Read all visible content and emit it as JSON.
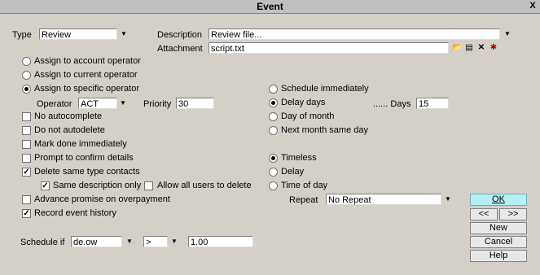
{
  "window": {
    "title": "Event",
    "close": "X"
  },
  "type": {
    "label": "Type",
    "value": "Review"
  },
  "description": {
    "label": "Description",
    "value": "Review file..."
  },
  "attachment": {
    "label": "Attachment",
    "value": "script.txt"
  },
  "assign_options": [
    {
      "label": "Assign to account operator",
      "selected": false
    },
    {
      "label": "Assign to current operator",
      "selected": false
    },
    {
      "label": "Assign to specific operator",
      "selected": true
    }
  ],
  "operator": {
    "label": "Operator",
    "value": "ACT"
  },
  "priority": {
    "label": "Priority",
    "value": "30"
  },
  "checks": {
    "no_autocomplete": {
      "label": "No autocomplete",
      "checked": false
    },
    "do_not_autodelete": {
      "label": "Do not autodelete",
      "checked": false
    },
    "mark_done": {
      "label": "Mark done immediately",
      "checked": false
    },
    "prompt_confirm": {
      "label": "Prompt to confirm details",
      "checked": false
    },
    "delete_same_type": {
      "label": "Delete same type contacts",
      "checked": true
    },
    "same_description": {
      "label": "Same description only",
      "checked": true
    },
    "allow_all_users": {
      "label": "Allow all users to delete",
      "checked": false
    },
    "advance_promise": {
      "label": "Advance promise on overpayment",
      "checked": false
    },
    "record_history": {
      "label": "Record event history",
      "checked": true
    }
  },
  "schedule": {
    "immediately": "Schedule immediately",
    "delay_days": "Delay days",
    "day_of_month": "Day of month",
    "next_month": "Next month same day",
    "days_label": "...... Days",
    "days_value": "15",
    "selected": "delay_days"
  },
  "timing": {
    "timeless": "Timeless",
    "delay": "Delay",
    "time_of_day": "Time of day",
    "selected": "timeless"
  },
  "repeat": {
    "label": "Repeat",
    "value": "No Repeat"
  },
  "schedule_if": {
    "label": "Schedule if",
    "field": "de.ow",
    "operator": ">",
    "value": "1.00"
  },
  "buttons": {
    "ok": "OK",
    "prev": "<<",
    "next": ">>",
    "new": "New",
    "cancel": "Cancel",
    "help": "Help"
  },
  "colors": {
    "background": "#d4d0c8",
    "ok_button": "#b4f0f4"
  }
}
